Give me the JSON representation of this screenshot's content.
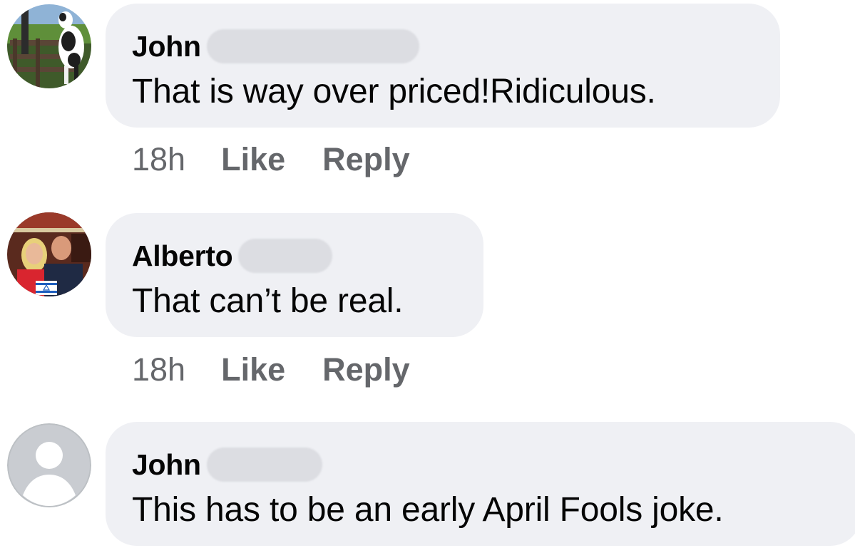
{
  "comments": [
    {
      "author": "John",
      "text": "That is way over priced!Ridiculous.",
      "time": "18h",
      "like_label": "Like",
      "reply_label": "Reply",
      "avatar_icon": "dog-photo-avatar"
    },
    {
      "author": "Alberto",
      "text": "That can’t be real.",
      "time": "18h",
      "like_label": "Like",
      "reply_label": "Reply",
      "avatar_icon": "couple-photo-avatar"
    },
    {
      "author": "John",
      "text": "This has to be an early April Fools joke.",
      "avatar_icon": "default-user-avatar"
    }
  ],
  "colors": {
    "bubble": "#eff0f4",
    "text": "#050505",
    "secondary_text": "#65676b",
    "redaction": "#dcdde2"
  }
}
